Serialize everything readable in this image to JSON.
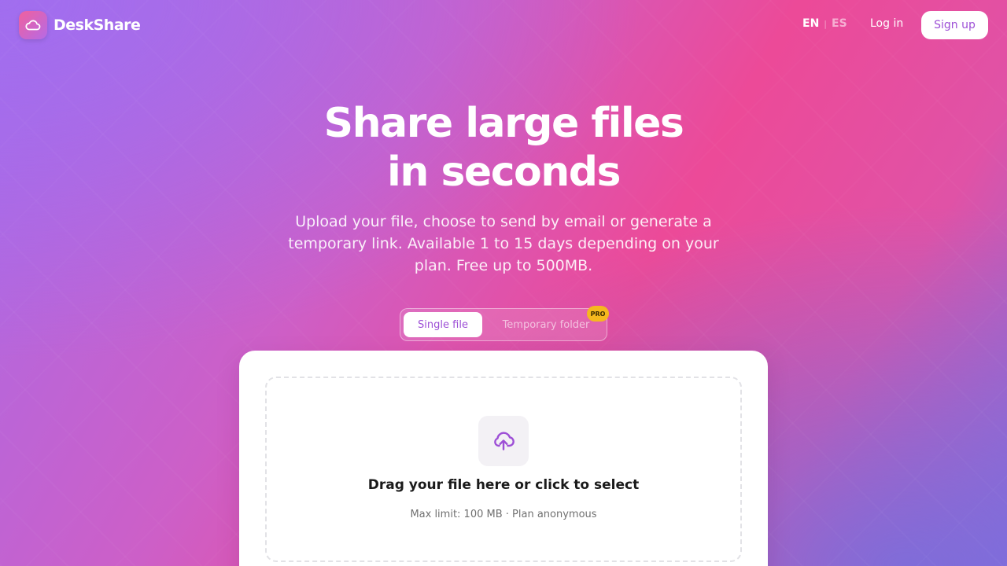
{
  "brand": {
    "name": "DeskShare",
    "logo_icon": "cloud-icon"
  },
  "nav": {
    "lang_en": "EN",
    "lang_separator": "|",
    "lang_es": "ES",
    "login_label": "Log in",
    "signup_label": "Sign up"
  },
  "hero": {
    "title_line1": "Share large files",
    "title_line2": "in seconds",
    "subtitle": "Upload your file, choose to send by email or generate a temporary link. Available 1 to 15 days depending on your plan. Free up to 500MB."
  },
  "tabs": {
    "single_label": "Single file",
    "folder_label": "Temporary folder",
    "pro_badge": "PRO",
    "selected": "Single file"
  },
  "dropzone": {
    "icon": "cloud-upload-icon",
    "title": "Drag your file here or click to select",
    "meta": "Max limit: 100 MB · Plan anonymous"
  },
  "colors": {
    "accent": "#9d4fd6",
    "pro_badge": "#f5b81e",
    "gradient_pink": "#ec4a98",
    "gradient_purple": "#a86be8"
  }
}
